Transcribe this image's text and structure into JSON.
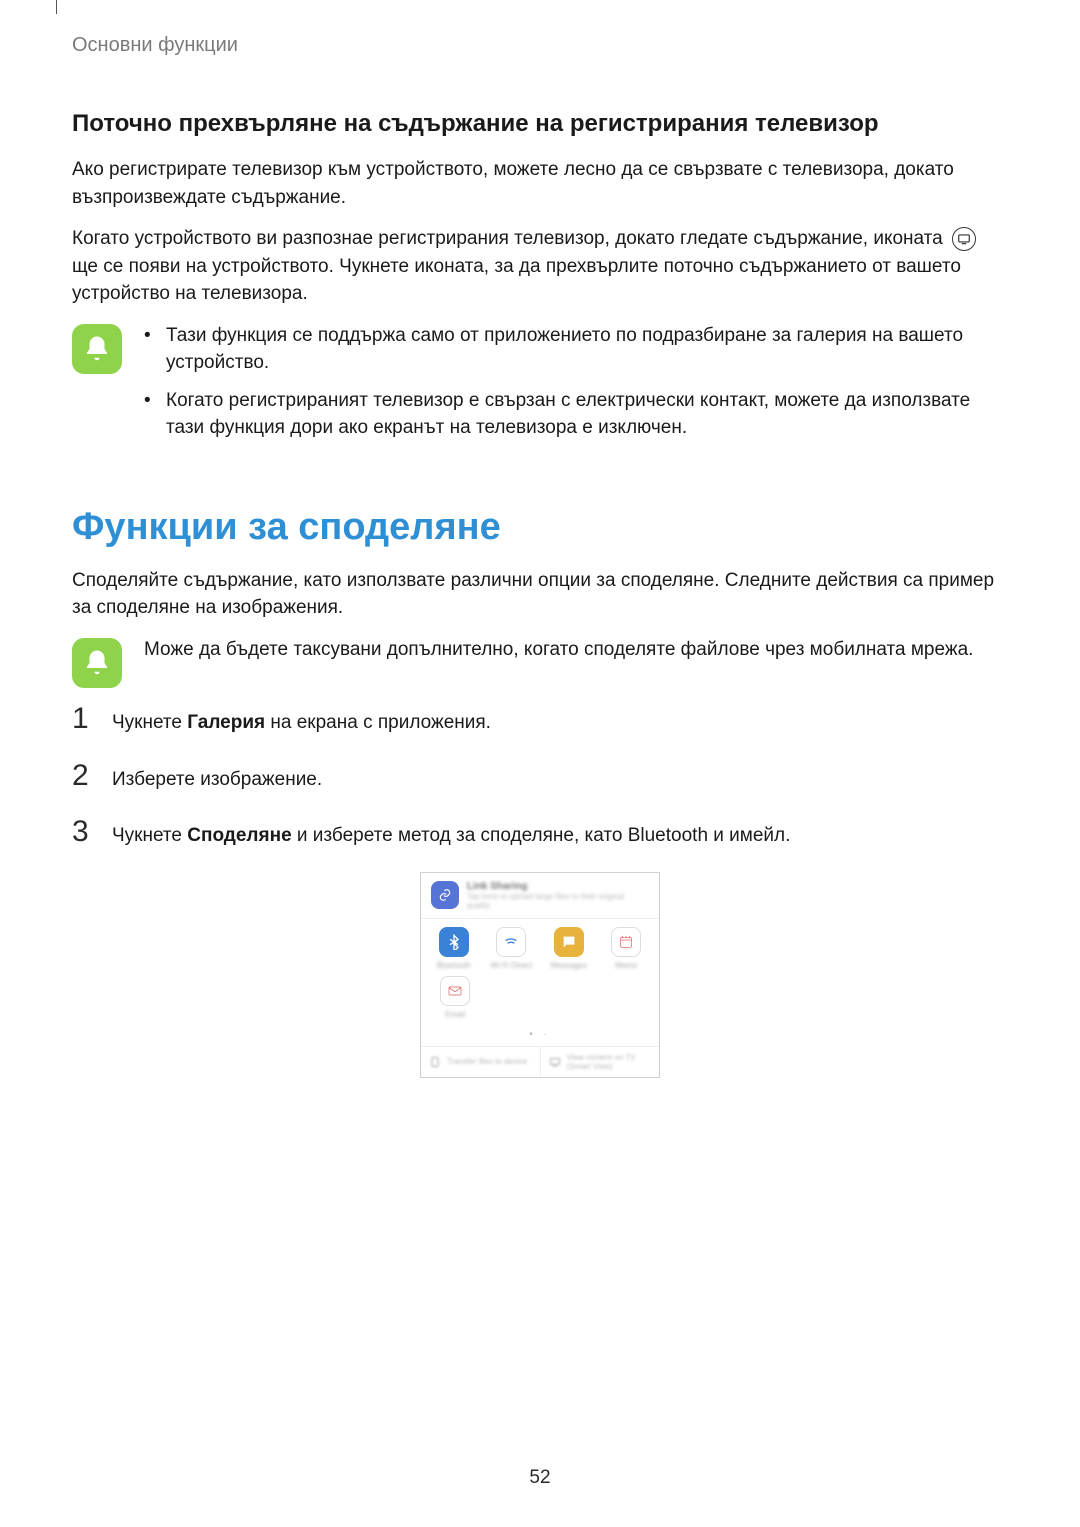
{
  "breadcrumb": "Основни функции",
  "section_heading": "Поточно прехвърляне на съдържание на регистрирания телевизор",
  "para1": "Ако регистрирате телевизор към устройството, можете лесно да се свързвате с телевизора, докато възпроизвеждате съдържание.",
  "para2_a": "Когато устройството ви разпознае регистрирания телевизор, докато гледате съдържание, иконата",
  "para2_b": "ще се появи на устройството. Чукнете иконата, за да прехвърлите поточно съдържанието от вашето устройство на телевизора.",
  "note1": {
    "items": [
      "Тази функция се поддържа само от приложението по подразбиране за галерия на вашето устройство.",
      "Когато регистрираният телевизор е свързан с електрически контакт, можете да използвате тази функция дори ако екранът на телевизора е изключен."
    ]
  },
  "main_heading": "Функции за споделяне",
  "intro": "Споделяйте съдържание, като използвате различни опции за споделяне. Следните действия са пример за споделяне на изображения.",
  "note2": "Може да бъдете таксувани допълнително, когато споделяте файлове чрез мобилната мрежа.",
  "steps": [
    {
      "num": "1",
      "pre": "Чукнете ",
      "bold": "Галерия",
      "post": " на екрана с приложения."
    },
    {
      "num": "2",
      "pre": "Изберете изображение.",
      "bold": "",
      "post": ""
    },
    {
      "num": "3",
      "pre": "Чукнете ",
      "bold": "Споделяне",
      "post": " и изберете метод за споделяне, като Bluetooth и имейл."
    }
  ],
  "share_panel": {
    "header_title": "Link Sharing",
    "header_sub": "Tap here to upload large files to their original quality",
    "items_row1": [
      {
        "label": "Bluetooth"
      },
      {
        "label": "Wi-Fi Direct"
      },
      {
        "label": "Messages"
      },
      {
        "label": "Memo"
      }
    ],
    "items_row2": [
      {
        "label": "Email"
      }
    ],
    "footer_left": "Transfer files to device",
    "footer_right": "View content on TV (Smart View)"
  },
  "page_number": "52"
}
